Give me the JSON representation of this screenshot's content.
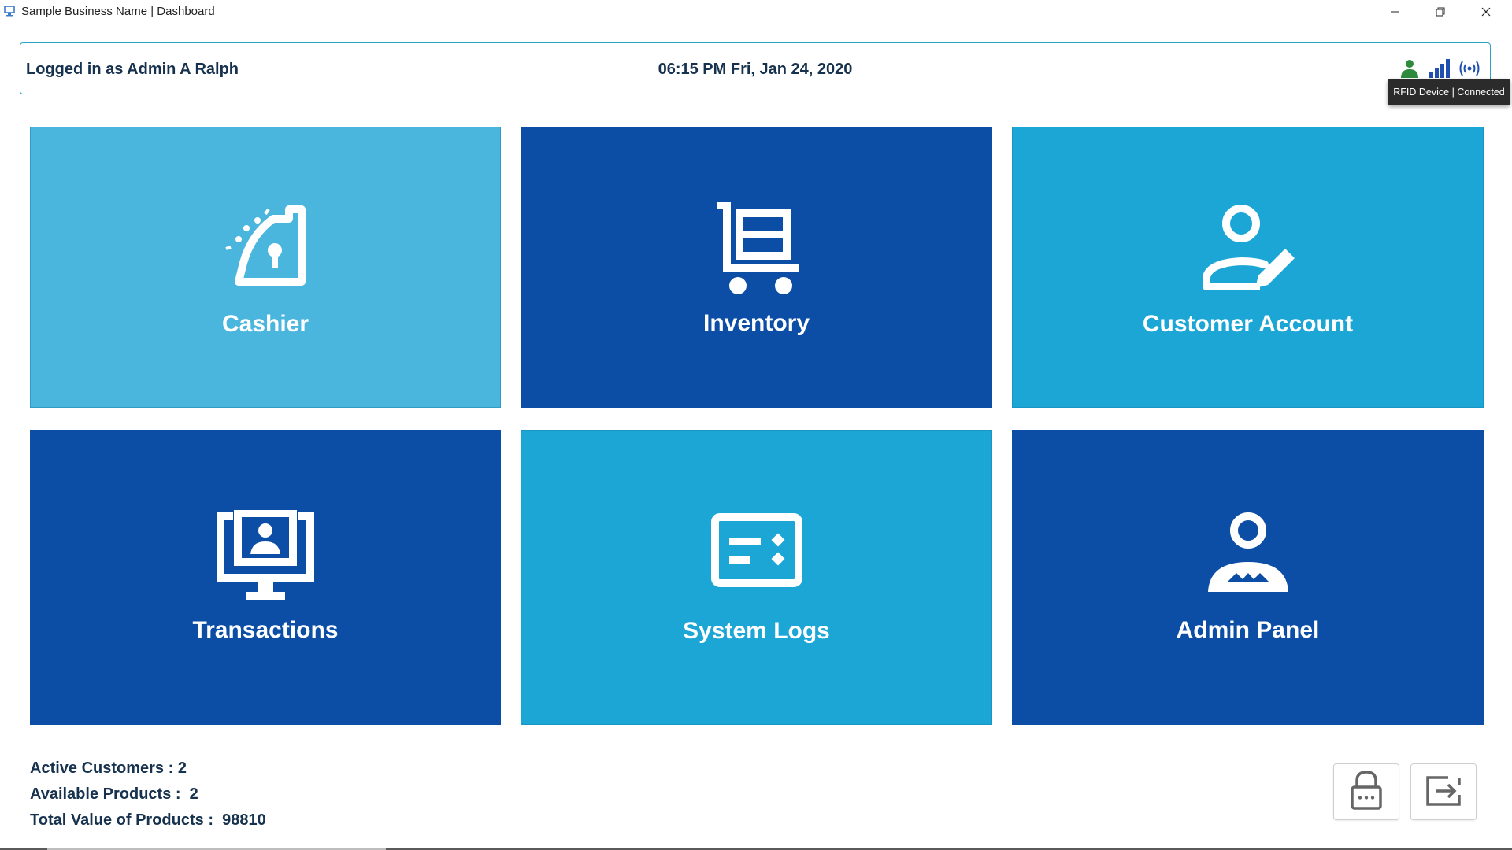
{
  "window": {
    "title": "Sample Business Name | Dashboard",
    "icon": "app-monitor-icon",
    "controls": [
      "minimize-icon",
      "restore-icon",
      "close-icon"
    ]
  },
  "status_bar": {
    "logged_in_text": "Logged in as Admin A Ralph",
    "datetime": "06:15 PM Fri, Jan 24, 2020",
    "icons": [
      "user-status-icon",
      "signal-bars-icon",
      "rfid-wireless-icon"
    ],
    "tooltip": "RFID Device | Connected"
  },
  "tiles": [
    {
      "label": "Cashier",
      "icon": "cash-register-icon",
      "color": "#4ab6dd"
    },
    {
      "label": "Inventory",
      "icon": "cart-icon",
      "color": "#0c4ea6"
    },
    {
      "label": "Customer Account",
      "icon": "user-edit-icon",
      "color": "#1ba6d6"
    },
    {
      "label": "Transactions",
      "icon": "monitor-user-icon",
      "color": "#0c4ea6"
    },
    {
      "label": "System Logs",
      "icon": "log-list-icon",
      "color": "#1ba6d6"
    },
    {
      "label": "Admin Panel",
      "icon": "admin-icon",
      "color": "#0c4ea6"
    }
  ],
  "stats": {
    "active_customers": "Active Customers : 2",
    "available_products": "Available Products :  2",
    "total_value": "Total Value of Products :  98810"
  },
  "actions": {
    "lock_icon": "lock-icon",
    "logout_icon": "logout-icon"
  },
  "colors": {
    "accent_dark": "#0c4ea6",
    "accent_light": "#1ba6d6",
    "text": "#17324e"
  }
}
